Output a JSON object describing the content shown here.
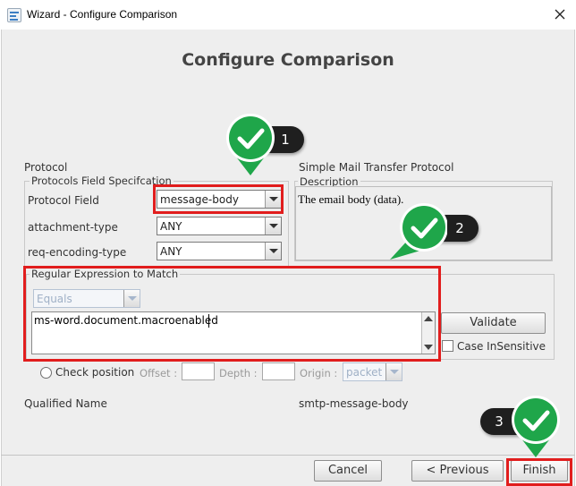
{
  "window": {
    "title": "Wizard - Configure Comparison",
    "heading": "Configure Comparison"
  },
  "protocol": {
    "section_label": "Protocol",
    "group_legend": "Protocols Field Specifcation",
    "fields": [
      {
        "label": "Protocol Field",
        "value": "message-body"
      },
      {
        "label": "attachment-type",
        "value": "ANY"
      },
      {
        "label": "req-encoding-type",
        "value": "ANY"
      }
    ]
  },
  "description": {
    "protocol_name": "Simple Mail Transfer Protocol",
    "legend": "Description",
    "text": "The email body (data)."
  },
  "regex": {
    "legend": "Regular Expression to Match",
    "operator": "Equals",
    "value": "ms-word.document.macroenabled",
    "validate_label": "Validate",
    "case_insensitive_label": "Case InSensitive"
  },
  "position": {
    "check_label": "Check position",
    "offset_label": "Offset :",
    "depth_label": "Depth :",
    "origin_label": "Origin :",
    "origin_value": "packet"
  },
  "qualified": {
    "label": "Qualified Name",
    "value": "smtp-message-body"
  },
  "buttons": {
    "cancel": "Cancel",
    "previous": "< Previous",
    "finish": "Finish"
  },
  "callouts": [
    "1",
    "2",
    "3"
  ],
  "colors": {
    "highlight": "#e11d1d",
    "badge_green": "#1fa64a",
    "pill_dark": "#1f1f1f"
  }
}
